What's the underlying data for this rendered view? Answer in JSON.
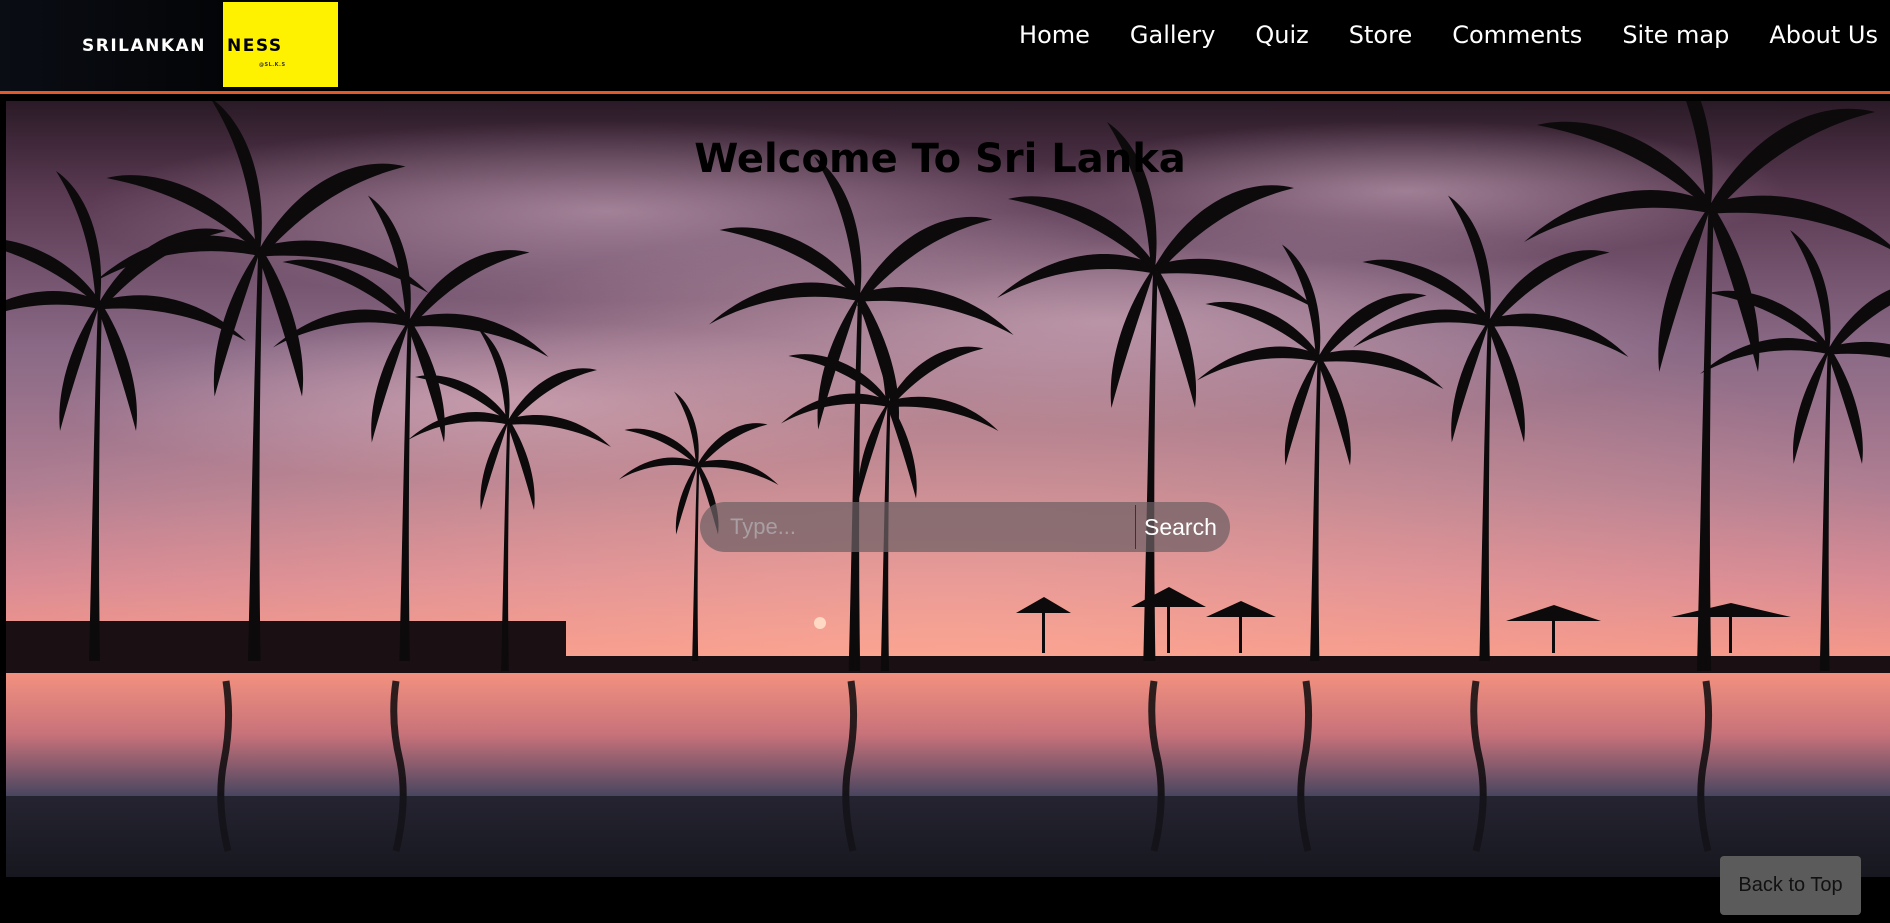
{
  "header": {
    "logo": {
      "text_left": "SRILANKAN",
      "text_box": "NESS",
      "text_sub": "@SL.K.S"
    },
    "nav": [
      {
        "label": "Home"
      },
      {
        "label": "Gallery"
      },
      {
        "label": "Quiz"
      },
      {
        "label": "Store"
      },
      {
        "label": "Comments"
      },
      {
        "label": "Site map"
      },
      {
        "label": "About Us"
      }
    ]
  },
  "hero": {
    "title": "Welcome To Sri Lanka",
    "search": {
      "placeholder": "Type...",
      "button_label": "Search"
    }
  },
  "back_to_top_label": "Back to Top",
  "colors": {
    "accent_rule": "#e05a2a",
    "logo_yellow": "#fff200",
    "header_bg": "#000000"
  }
}
